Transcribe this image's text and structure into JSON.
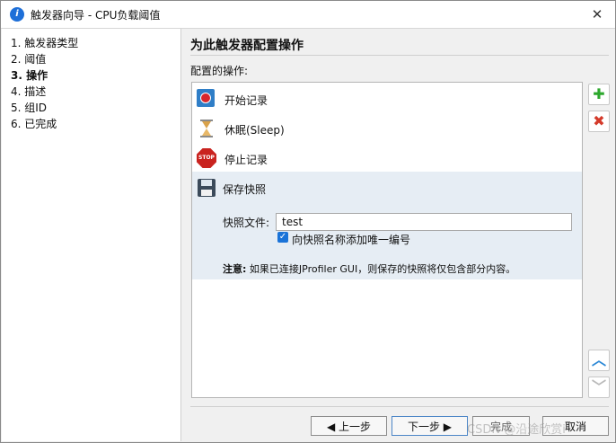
{
  "window": {
    "title": "触发器向导 - CPU负载阈值",
    "close_glyph": "✕",
    "app_icon_glyph": "i"
  },
  "steps": [
    {
      "label": "1. 触发器类型",
      "current": false
    },
    {
      "label": "2. 阈值",
      "current": false
    },
    {
      "label": "3. 操作",
      "current": true
    },
    {
      "label": "4. 描述",
      "current": false
    },
    {
      "label": "5. 组ID",
      "current": false
    },
    {
      "label": "6. 已完成",
      "current": false
    }
  ],
  "main": {
    "heading": "为此触发器配置操作",
    "subhead": "配置的操作:",
    "actions": [
      {
        "label": "开始记录",
        "icon": "record-icon"
      },
      {
        "label": "休眠(Sleep)",
        "icon": "hourglass-icon"
      },
      {
        "label": "停止记录",
        "icon": "stop-sign-icon"
      },
      {
        "label": "保存快照",
        "icon": "floppy-disk-icon"
      }
    ],
    "stop_icon_text": "STOP",
    "snapshot": {
      "file_label": "快照文件:",
      "file_value": "test",
      "unique_label": "向快照名称添加唯一编号",
      "unique_checked": true,
      "note_prefix": "注意:",
      "note_text": "如果已连接JProfiler GUI，则保存的快照将仅包含部分内容。"
    }
  },
  "side_buttons": {
    "add": "✚",
    "remove": "✖",
    "up": "︿",
    "down": "﹀"
  },
  "footer": {
    "back": "◀ 上一步",
    "next": "下一步 ▶",
    "finish": "完成",
    "cancel": "取消",
    "watermark": "CSDN @沿途欣赏i"
  }
}
